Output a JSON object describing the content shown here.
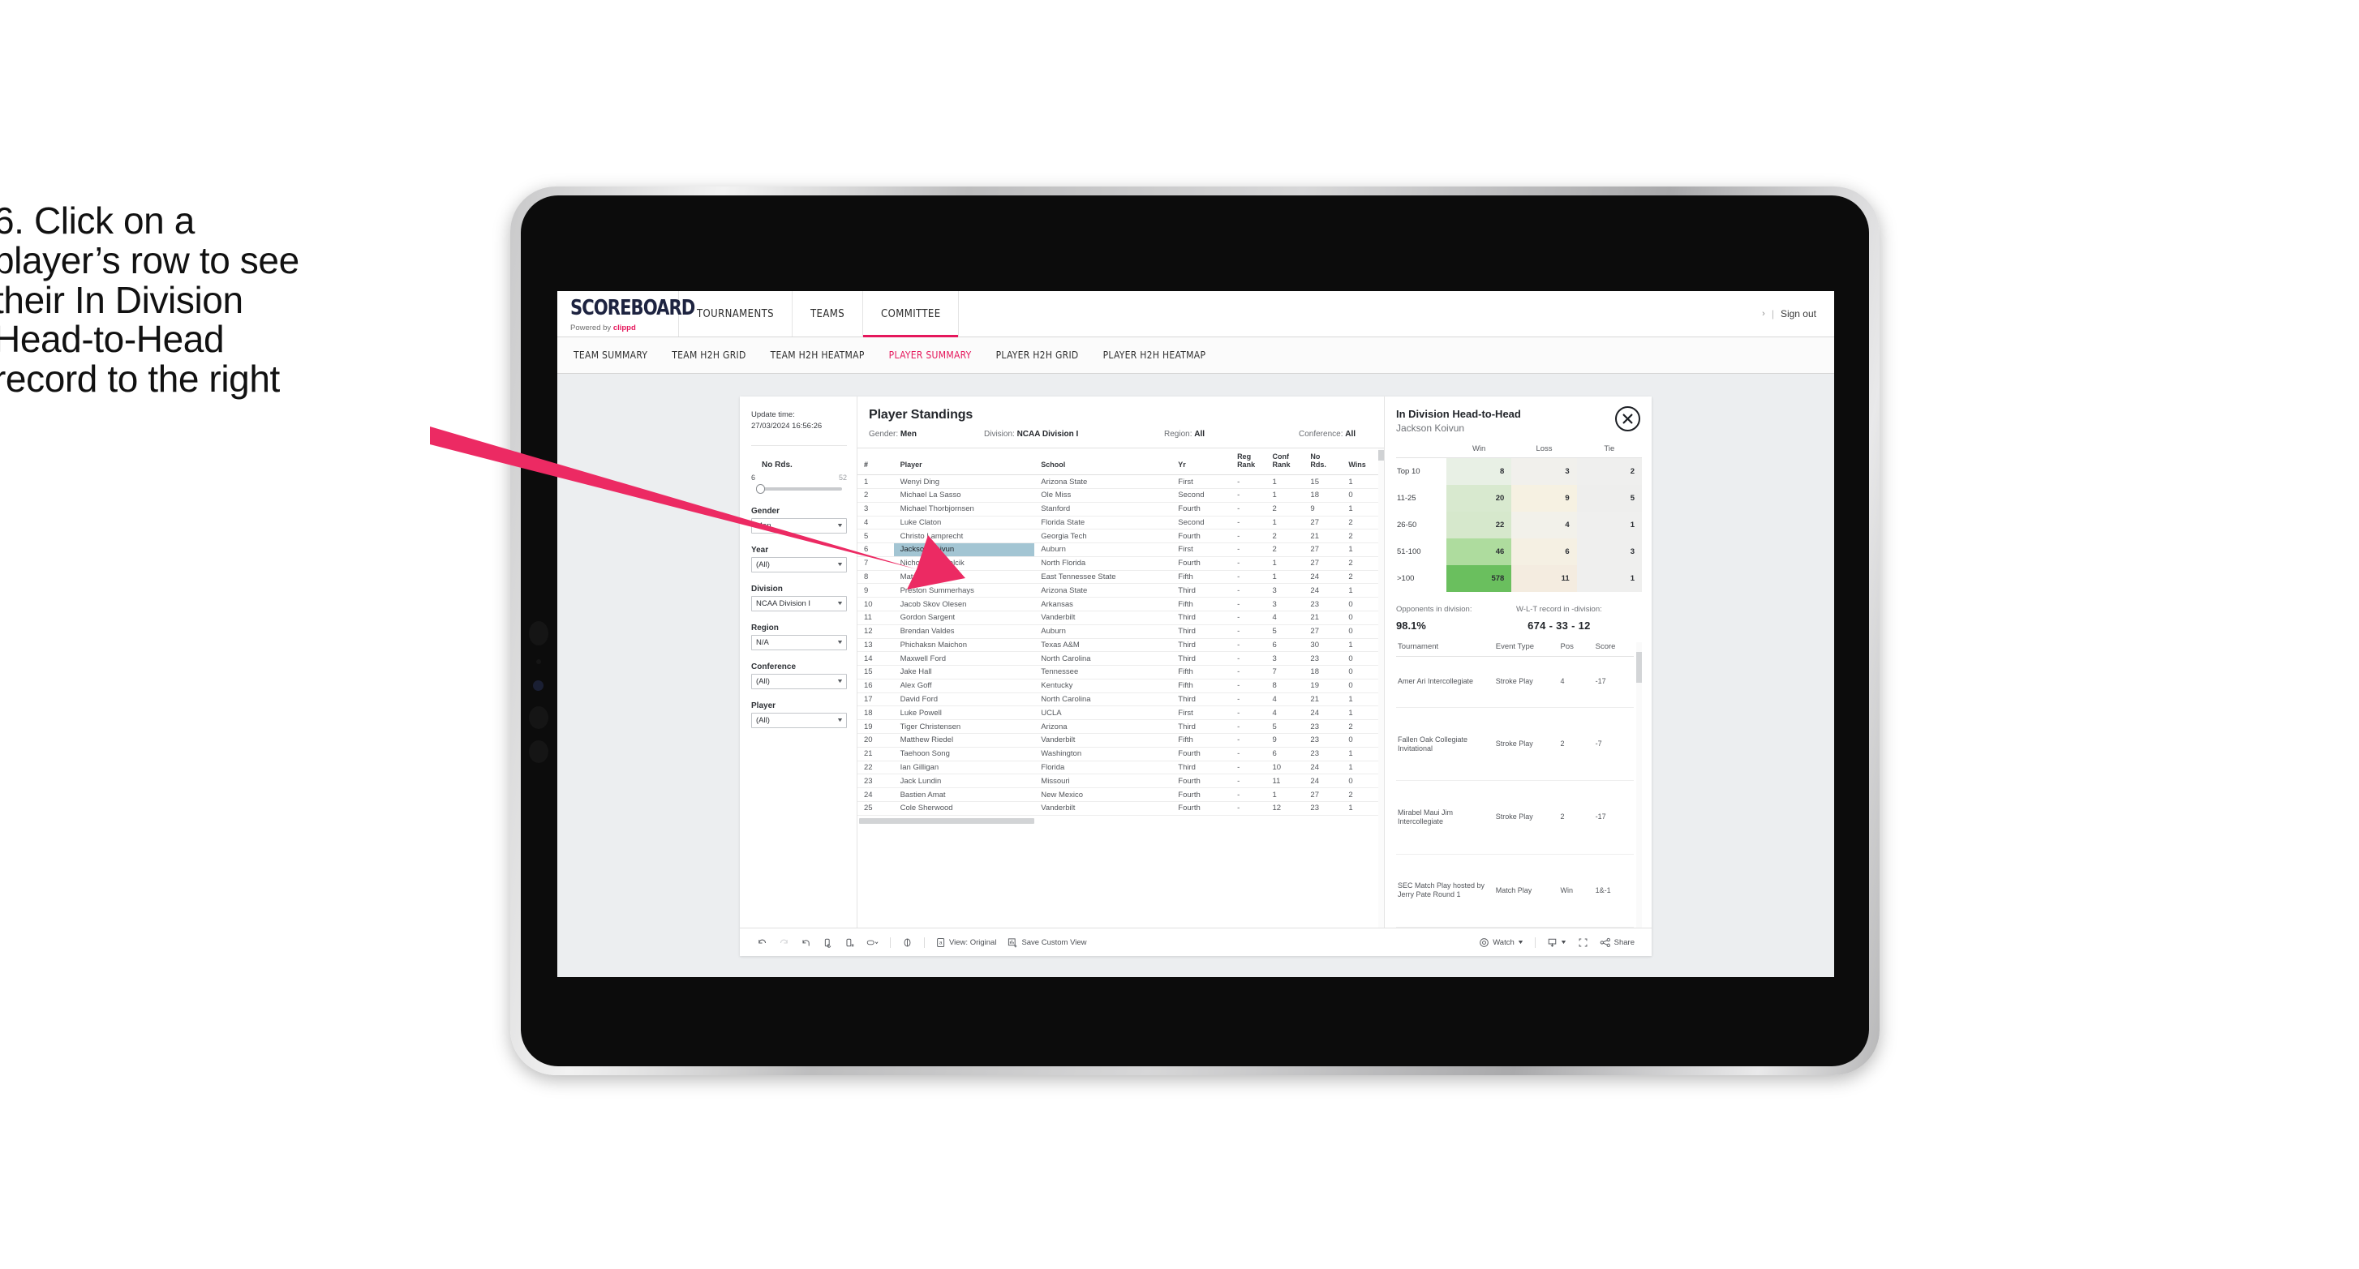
{
  "caption": {
    "lines": [
      "6. Click on a",
      "player’s row to see",
      "their In Division",
      "Head-to-Head",
      "record to the right"
    ]
  },
  "colors": {
    "accent_pink": "#e5175c",
    "arrow_pink": "#ec2a63",
    "selected_row": "#a3c5d3",
    "heat_green_max": "#6abf5e",
    "device_body": "#c9c9ca"
  },
  "app": {
    "logo_main": "SCOREBOARD",
    "logo_sub_prefix": "Powered by ",
    "logo_sub_brand": "clippd",
    "top_nav": [
      {
        "label": "TOURNAMENTS",
        "active": false
      },
      {
        "label": "TEAMS",
        "active": false
      },
      {
        "label": "COMMITTEE",
        "active": true
      }
    ],
    "account": {
      "dots": "›",
      "separator": "|",
      "sign_out": "Sign out"
    },
    "sub_nav": [
      {
        "label": "TEAM SUMMARY",
        "active": false
      },
      {
        "label": "TEAM H2H GRID",
        "active": false
      },
      {
        "label": "TEAM H2H HEATMAP",
        "active": false
      },
      {
        "label": "PLAYER SUMMARY",
        "active": true
      },
      {
        "label": "PLAYER H2H GRID",
        "active": false
      },
      {
        "label": "PLAYER H2H HEATMAP",
        "active": false
      }
    ]
  },
  "filters": {
    "update_time_label": "Update time:",
    "update_time_value": "27/03/2024 16:56:26",
    "slider": {
      "title": "No Rds.",
      "min": "6",
      "max": "52"
    },
    "groups": [
      {
        "label": "Gender",
        "value": "Men"
      },
      {
        "label": "Year",
        "value": "(All)"
      },
      {
        "label": "Division",
        "value": "NCAA Division I"
      },
      {
        "label": "Region",
        "value": "N/A"
      },
      {
        "label": "Conference",
        "value": "(All)"
      },
      {
        "label": "Player",
        "value": "(All)"
      }
    ]
  },
  "standings": {
    "title": "Player Standings",
    "meta": [
      {
        "label": "Gender: ",
        "value": "Men"
      },
      {
        "label": "Division: ",
        "value": "NCAA Division I"
      },
      {
        "label": "Region: ",
        "value": "All"
      },
      {
        "label": "Conference: ",
        "value": "All"
      }
    ],
    "columns": [
      "#",
      "Player",
      "School",
      "Yr",
      "Reg Rank",
      "Conf Rank",
      "No Rds.",
      "Wins"
    ],
    "column_lines": [
      [
        "#",
        ""
      ],
      [
        "Player",
        ""
      ],
      [
        "School",
        ""
      ],
      [
        "Yr",
        ""
      ],
      [
        "Reg",
        "Rank"
      ],
      [
        "Conf",
        "Rank"
      ],
      [
        "No",
        "Rds."
      ],
      [
        "Wins",
        ""
      ]
    ],
    "rows": [
      {
        "num": "1",
        "player": "Wenyi Ding",
        "school": "Arizona State",
        "yr": "First",
        "reg": "-",
        "conf": "1",
        "nords": "15",
        "wins": "1",
        "selected": false
      },
      {
        "num": "2",
        "player": "Michael La Sasso",
        "school": "Ole Miss",
        "yr": "Second",
        "reg": "-",
        "conf": "1",
        "nords": "18",
        "wins": "0",
        "selected": false
      },
      {
        "num": "3",
        "player": "Michael Thorbjornsen",
        "school": "Stanford",
        "yr": "Fourth",
        "reg": "-",
        "conf": "2",
        "nords": "9",
        "wins": "1",
        "selected": false
      },
      {
        "num": "4",
        "player": "Luke Claton",
        "school": "Florida State",
        "yr": "Second",
        "reg": "-",
        "conf": "1",
        "nords": "27",
        "wins": "2",
        "selected": false
      },
      {
        "num": "5",
        "player": "Christo Lamprecht",
        "school": "Georgia Tech",
        "yr": "Fourth",
        "reg": "-",
        "conf": "2",
        "nords": "21",
        "wins": "2",
        "selected": false
      },
      {
        "num": "6",
        "player": "Jackson Koivun",
        "school": "Auburn",
        "yr": "First",
        "reg": "-",
        "conf": "2",
        "nords": "27",
        "wins": "1",
        "selected": true
      },
      {
        "num": "7",
        "player": "Nicholas Gabrelcik",
        "school": "North Florida",
        "yr": "Fourth",
        "reg": "-",
        "conf": "1",
        "nords": "27",
        "wins": "2",
        "selected": false
      },
      {
        "num": "8",
        "player": "Mats Ege",
        "school": "East Tennessee State",
        "yr": "Fifth",
        "reg": "-",
        "conf": "1",
        "nords": "24",
        "wins": "2",
        "selected": false
      },
      {
        "num": "9",
        "player": "Preston Summerhays",
        "school": "Arizona State",
        "yr": "Third",
        "reg": "-",
        "conf": "3",
        "nords": "24",
        "wins": "1",
        "selected": false
      },
      {
        "num": "10",
        "player": "Jacob Skov Olesen",
        "school": "Arkansas",
        "yr": "Fifth",
        "reg": "-",
        "conf": "3",
        "nords": "23",
        "wins": "0",
        "selected": false
      },
      {
        "num": "11",
        "player": "Gordon Sargent",
        "school": "Vanderbilt",
        "yr": "Third",
        "reg": "-",
        "conf": "4",
        "nords": "21",
        "wins": "0",
        "selected": false
      },
      {
        "num": "12",
        "player": "Brendan Valdes",
        "school": "Auburn",
        "yr": "Third",
        "reg": "-",
        "conf": "5",
        "nords": "27",
        "wins": "0",
        "selected": false
      },
      {
        "num": "13",
        "player": "Phichaksn Maichon",
        "school": "Texas A&M",
        "yr": "Third",
        "reg": "-",
        "conf": "6",
        "nords": "30",
        "wins": "1",
        "selected": false
      },
      {
        "num": "14",
        "player": "Maxwell Ford",
        "school": "North Carolina",
        "yr": "Third",
        "reg": "-",
        "conf": "3",
        "nords": "23",
        "wins": "0",
        "selected": false
      },
      {
        "num": "15",
        "player": "Jake Hall",
        "school": "Tennessee",
        "yr": "Fifth",
        "reg": "-",
        "conf": "7",
        "nords": "18",
        "wins": "0",
        "selected": false
      },
      {
        "num": "16",
        "player": "Alex Goff",
        "school": "Kentucky",
        "yr": "Fifth",
        "reg": "-",
        "conf": "8",
        "nords": "19",
        "wins": "0",
        "selected": false
      },
      {
        "num": "17",
        "player": "David Ford",
        "school": "North Carolina",
        "yr": "Third",
        "reg": "-",
        "conf": "4",
        "nords": "21",
        "wins": "1",
        "selected": false
      },
      {
        "num": "18",
        "player": "Luke Powell",
        "school": "UCLA",
        "yr": "First",
        "reg": "-",
        "conf": "4",
        "nords": "24",
        "wins": "1",
        "selected": false
      },
      {
        "num": "19",
        "player": "Tiger Christensen",
        "school": "Arizona",
        "yr": "Third",
        "reg": "-",
        "conf": "5",
        "nords": "23",
        "wins": "2",
        "selected": false
      },
      {
        "num": "20",
        "player": "Matthew Riedel",
        "school": "Vanderbilt",
        "yr": "Fifth",
        "reg": "-",
        "conf": "9",
        "nords": "23",
        "wins": "0",
        "selected": false
      },
      {
        "num": "21",
        "player": "Taehoon Song",
        "school": "Washington",
        "yr": "Fourth",
        "reg": "-",
        "conf": "6",
        "nords": "23",
        "wins": "1",
        "selected": false
      },
      {
        "num": "22",
        "player": "Ian Gilligan",
        "school": "Florida",
        "yr": "Third",
        "reg": "-",
        "conf": "10",
        "nords": "24",
        "wins": "1",
        "selected": false
      },
      {
        "num": "23",
        "player": "Jack Lundin",
        "school": "Missouri",
        "yr": "Fourth",
        "reg": "-",
        "conf": "11",
        "nords": "24",
        "wins": "0",
        "selected": false
      },
      {
        "num": "24",
        "player": "Bastien Amat",
        "school": "New Mexico",
        "yr": "Fourth",
        "reg": "-",
        "conf": "1",
        "nords": "27",
        "wins": "2",
        "selected": false
      },
      {
        "num": "25",
        "player": "Cole Sherwood",
        "school": "Vanderbilt",
        "yr": "Fourth",
        "reg": "-",
        "conf": "12",
        "nords": "23",
        "wins": "1",
        "selected": false
      }
    ]
  },
  "h2h": {
    "title": "In Division Head-to-Head",
    "player": "Jackson Koivun",
    "close_icon": "close-circle-icon",
    "heat_columns": [
      "Win",
      "Loss",
      "Tie"
    ],
    "heat_rows": [
      {
        "label": "Top 10",
        "win": "8",
        "loss": "3",
        "tie": "2",
        "win_color": "#e8f0e5",
        "loss_color": "#f1f0ec",
        "tie_color": "#efefee"
      },
      {
        "label": "11-25",
        "win": "20",
        "loss": "9",
        "tie": "5",
        "win_color": "#d8e9cf",
        "loss_color": "#f6f1e2",
        "tie_color": "#eeeeed"
      },
      {
        "label": "26-50",
        "win": "22",
        "loss": "4",
        "tie": "1",
        "win_color": "#d6e8cc",
        "loss_color": "#f2f1ea",
        "tie_color": "#efefee"
      },
      {
        "label": "51-100",
        "win": "46",
        "loss": "6",
        "tie": "3",
        "win_color": "#aedc9e",
        "loss_color": "#f5f0e3",
        "tie_color": "#efefee"
      },
      {
        "label": ">100",
        "win": "578",
        "loss": "11",
        "tie": "1",
        "win_color": "#6abf5e",
        "loss_color": "#f4ece0",
        "tie_color": "#efefee"
      }
    ],
    "stats": [
      {
        "label": "Opponents in division:",
        "value": "98.1%"
      },
      {
        "label": "W-L-T record in -division:",
        "value": "674 - 33 - 12"
      }
    ],
    "tournament_columns": [
      "Tournament",
      "Event Type",
      "Pos",
      "Score"
    ],
    "tournaments": [
      {
        "name": "Amer Ari Intercollegiate",
        "type": "Stroke Play",
        "pos": "4",
        "score": "-17"
      },
      {
        "name": "Fallen Oak Collegiate Invitational",
        "type": "Stroke Play",
        "pos": "2",
        "score": "-7"
      },
      {
        "name": "Mirabel Maui Jim Intercollegiate",
        "type": "Stroke Play",
        "pos": "2",
        "score": "-17"
      },
      {
        "name": "SEC Match Play hosted by Jerry Pate Round 1",
        "type": "Match Play",
        "pos": "Win",
        "score": "1&-1"
      }
    ]
  },
  "toolbar": {
    "items": [
      {
        "name": "undo-icon",
        "label": ""
      },
      {
        "name": "redo-icon",
        "label": ""
      },
      {
        "name": "revert-icon",
        "label": ""
      },
      {
        "name": "refresh-data-icon",
        "label": ""
      },
      {
        "name": "pause-refresh-icon",
        "label": ""
      },
      {
        "name": "highlight-icon",
        "label": ""
      },
      {
        "name": "slideshow-icon",
        "label": ""
      }
    ],
    "view_label": "View: Original",
    "save_custom_view_label": "Save Custom View",
    "watch_label": "Watch",
    "share_label": "Share",
    "download_icon": "download-icon",
    "fullscreen_icon": "fullscreen-icon"
  }
}
